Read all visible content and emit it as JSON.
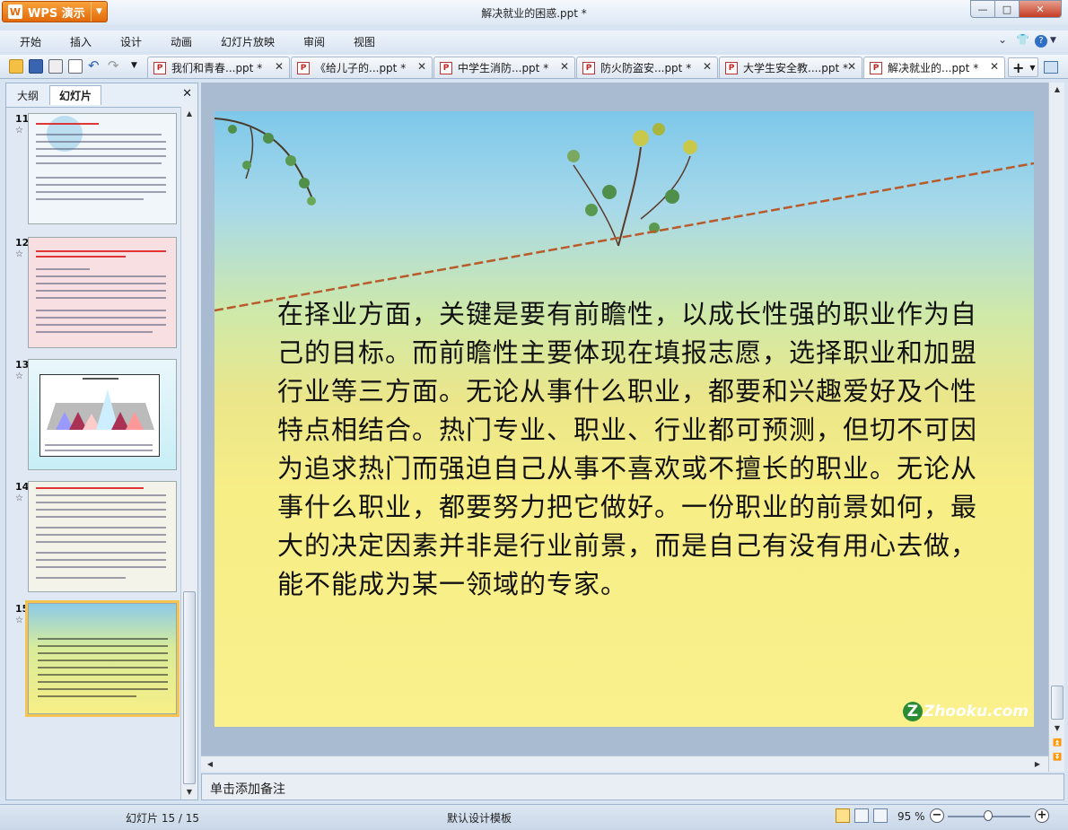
{
  "app": {
    "name": "WPS 演示",
    "window_title": "解决就业的困惑.ppt *"
  },
  "window_controls": {
    "minimize": "—",
    "maximize": "□",
    "close": "✕"
  },
  "menu": {
    "items": [
      "开始",
      "插入",
      "设计",
      "动画",
      "幻灯片放映",
      "审阅",
      "视图"
    ],
    "right_icons": [
      "chevron-down-icon",
      "shirt-icon",
      "help-icon"
    ]
  },
  "tabs": [
    {
      "label": "我们和青春...ppt *",
      "active": false
    },
    {
      "label": "《给儿子的...ppt *",
      "active": false
    },
    {
      "label": "中学生消防...ppt *",
      "active": false
    },
    {
      "label": "防火防盗安...ppt *",
      "active": false
    },
    {
      "label": "大学生安全教....ppt *",
      "active": false
    },
    {
      "label": "解决就业的...ppt *",
      "active": true
    }
  ],
  "tab_close_glyph": "✕",
  "new_tab_glyph": "+",
  "left_panel": {
    "tabs": [
      "大纲",
      "幻灯片"
    ],
    "active_tab": "幻灯片",
    "close_glyph": "✕",
    "slides": [
      {
        "number": "11",
        "star": "☆",
        "selected": false
      },
      {
        "number": "12",
        "star": "☆",
        "selected": false
      },
      {
        "number": "13",
        "star": "☆",
        "selected": false
      },
      {
        "number": "14",
        "star": "☆",
        "selected": false
      },
      {
        "number": "15",
        "star": "☆",
        "selected": true
      }
    ]
  },
  "slide": {
    "body_text": "在择业方面，关键是要有前瞻性，以成长性强的职业作为自己的目标。而前瞻性主要体现在填报志愿，选择职业和加盟行业等三方面。无论从事什么职业，都要和兴趣爱好及个性特点相结合。热门专业、职业、行业都可预测，但切不可因为追求热门而强迫自己从事不喜欢或不擅长的职业。无论从事什么职业，都要努力把它做好。一份职业的前景如何，最大的决定因素并非是行业前景，而是自己有没有用心去做，能不能成为某一领域的专家。",
    "watermark": "Zhooku.com"
  },
  "notes_placeholder": "单击添加备注",
  "status": {
    "slide_counter": "幻灯片 15 / 15",
    "template": "默认设计模板",
    "zoom": "95 %",
    "zoom_minus": "−",
    "zoom_plus": "+"
  },
  "colors": {
    "accent": "#e26a0a",
    "selection": "#f5c451",
    "panel": "#e6eef8"
  }
}
